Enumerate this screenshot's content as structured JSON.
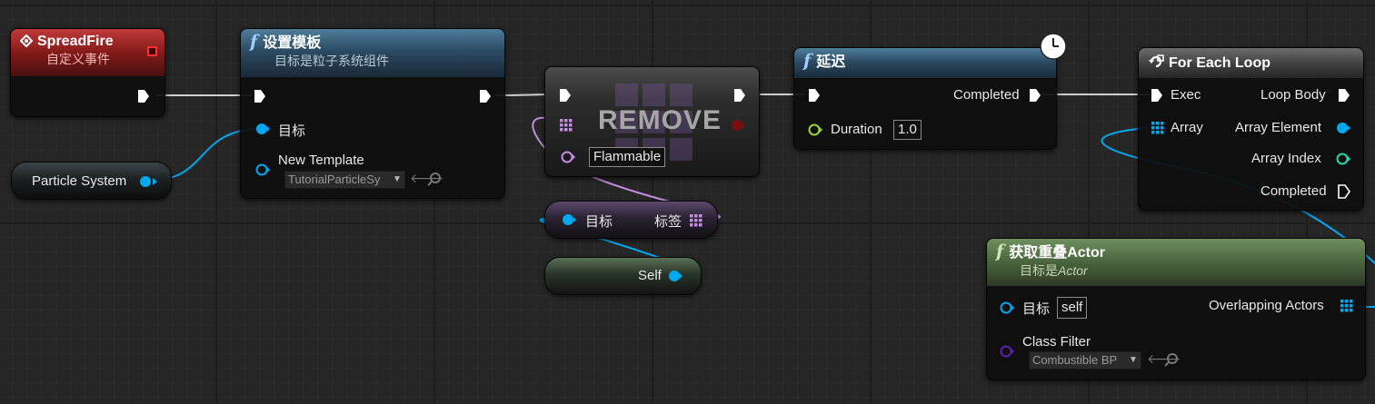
{
  "colors": {
    "exec": "#ffffff",
    "object_pin": "#00a8f0",
    "int_pin": "#1fdcae",
    "duration_pin": "#9cd63b",
    "name_pin": "#c38ee0",
    "class_pin": "#5c1fb0",
    "remove_output": "#7a0f0f",
    "event_header": "#8b1c1c",
    "function_header": "#2c4b63",
    "loop_header": "#3f3f3f",
    "pure_function_header": "#4a643e"
  },
  "spread_fire": {
    "icon": "event-diamond-icon",
    "title": "SpreadFire",
    "subtitle": "自定义事件"
  },
  "particle_system": {
    "label": "Particle System"
  },
  "set_template": {
    "icon": "function-icon",
    "title": "设置模板",
    "subtitle": "目标是粒子系统组件",
    "target_label": "目标",
    "new_template_label": "New Template",
    "new_template_value": "TutorialParticleSy"
  },
  "remove": {
    "title": "REMOVE",
    "input_value": "Flammable"
  },
  "tag_node": {
    "target_label": "目标",
    "tags_label": "标签"
  },
  "self_node": {
    "label": "Self"
  },
  "delay": {
    "icon": "function-icon",
    "title": "延迟",
    "completed_label": "Completed",
    "duration_label": "Duration",
    "duration_value": "1.0",
    "clock_icon": "clock-icon"
  },
  "for_each": {
    "icon": "loop-icon",
    "title": "For Each Loop",
    "exec_label": "Exec",
    "loop_body_label": "Loop Body",
    "array_label": "Array",
    "array_element_label": "Array Element",
    "array_index_label": "Array Index",
    "completed_label": "Completed"
  },
  "get_overlapping": {
    "icon": "function-icon",
    "title": "获取重叠Actor",
    "subtitle_prefix": "目标是",
    "subtitle_class": "Actor",
    "target_label": "目标",
    "target_value": "self",
    "overlapping_label": "Overlapping Actors",
    "class_filter_label": "Class Filter",
    "class_filter_value": "Combustible BP"
  }
}
